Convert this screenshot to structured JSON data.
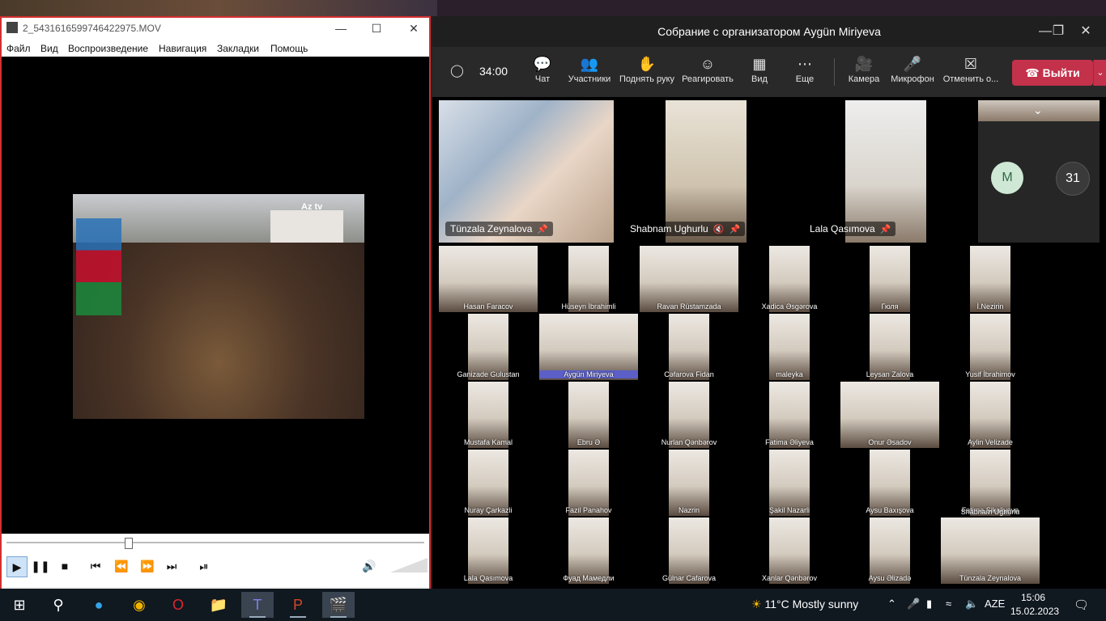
{
  "player": {
    "title": "2_5431616599746422975.MOV",
    "menu": [
      "Файл",
      "Вид",
      "Воспроизведение",
      "Навигация",
      "Закладки",
      "Помощь"
    ],
    "video_logo": "Az tv"
  },
  "teams": {
    "window_title": "Собрание с организатором Aygün Miriyeva",
    "timer": "34:00",
    "toolbar": {
      "chat": "Чат",
      "participants": "Участники",
      "raise_hand": "Поднять руку",
      "react": "Реагировать",
      "view": "Вид",
      "more": "Еще",
      "camera": "Камера",
      "mic": "Микрофон",
      "share": "Отменить о...",
      "leave": "Выйти"
    },
    "pinned": [
      "Tünzala Zeynalova",
      "Shabnam Ughurlu",
      "Lala Qasımova"
    ],
    "overflow_avatar": "M",
    "overflow_count": "31",
    "gallery": [
      "Hasan Faracov",
      "Hüseyn İbrahimli",
      "Ravan Rüstamzada",
      "Xadica Əsgərova",
      "Гюля",
      "İ.Nezirin",
      "Ganizade Gulustan",
      "Aygün Miriyeva",
      "Cəfarova Fidan",
      "maleyka",
      "Leysan Zalova",
      "Yusif İbrahimov",
      "Mustafa Kamal",
      "Ebru Ə",
      "Nurlan Qənbərov",
      "Fatima Əliyeva",
      "Onur Əsadov",
      "Aylin Velizade",
      "Nuray Çarkazli",
      "Fazil Panahov",
      "Nazrin",
      "Şakil Nazarli",
      "Aysu Baxışova",
      "Fatima Şikaliyeva",
      "Lala Qasımova",
      "Фуад Мамедли",
      "Gülnar Cafarova",
      "Xanlar Qənbərov",
      "Aysu Əlizadə",
      "Shabnam Ughurlu",
      "Tünzala Zeynalova"
    ]
  },
  "taskbar": {
    "temp": "11°C",
    "weather": "Mostly sunny",
    "lang": "AZE",
    "time": "15:06",
    "date": "15.02.2023"
  }
}
